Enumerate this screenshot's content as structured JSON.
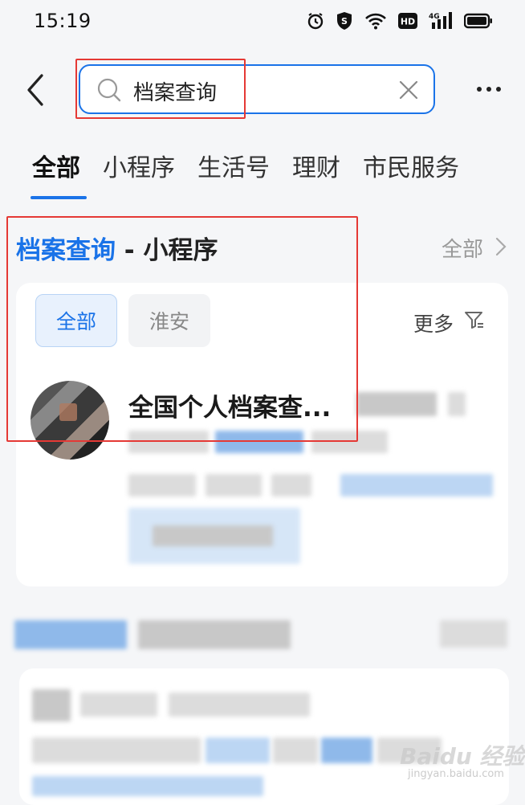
{
  "status_bar": {
    "time": "15:19",
    "icons": [
      "alarm-icon",
      "shield-icon",
      "wifi-icon",
      "hd-icon",
      "signal-4g-icon",
      "battery-icon"
    ]
  },
  "search": {
    "query": "档案查询",
    "accent": "#1a73e8"
  },
  "tabs": [
    {
      "label": "全部",
      "active": true
    },
    {
      "label": "小程序",
      "active": false
    },
    {
      "label": "生活号",
      "active": false
    },
    {
      "label": "理财",
      "active": false
    },
    {
      "label": "市民服务",
      "active": false
    }
  ],
  "section": {
    "keyword": "档案查询",
    "suffix": " - 小程序",
    "all_link": "全部"
  },
  "filters": {
    "chips": [
      "全部",
      "淮安"
    ],
    "more": "更多"
  },
  "result": {
    "title": "全国个人档案查..."
  },
  "watermark": {
    "brand": "Baidu 经验",
    "url": "jingyan.baidu.com"
  },
  "colors": {
    "highlight_box": "#e53935",
    "brand_blue": "#1a73e8"
  }
}
